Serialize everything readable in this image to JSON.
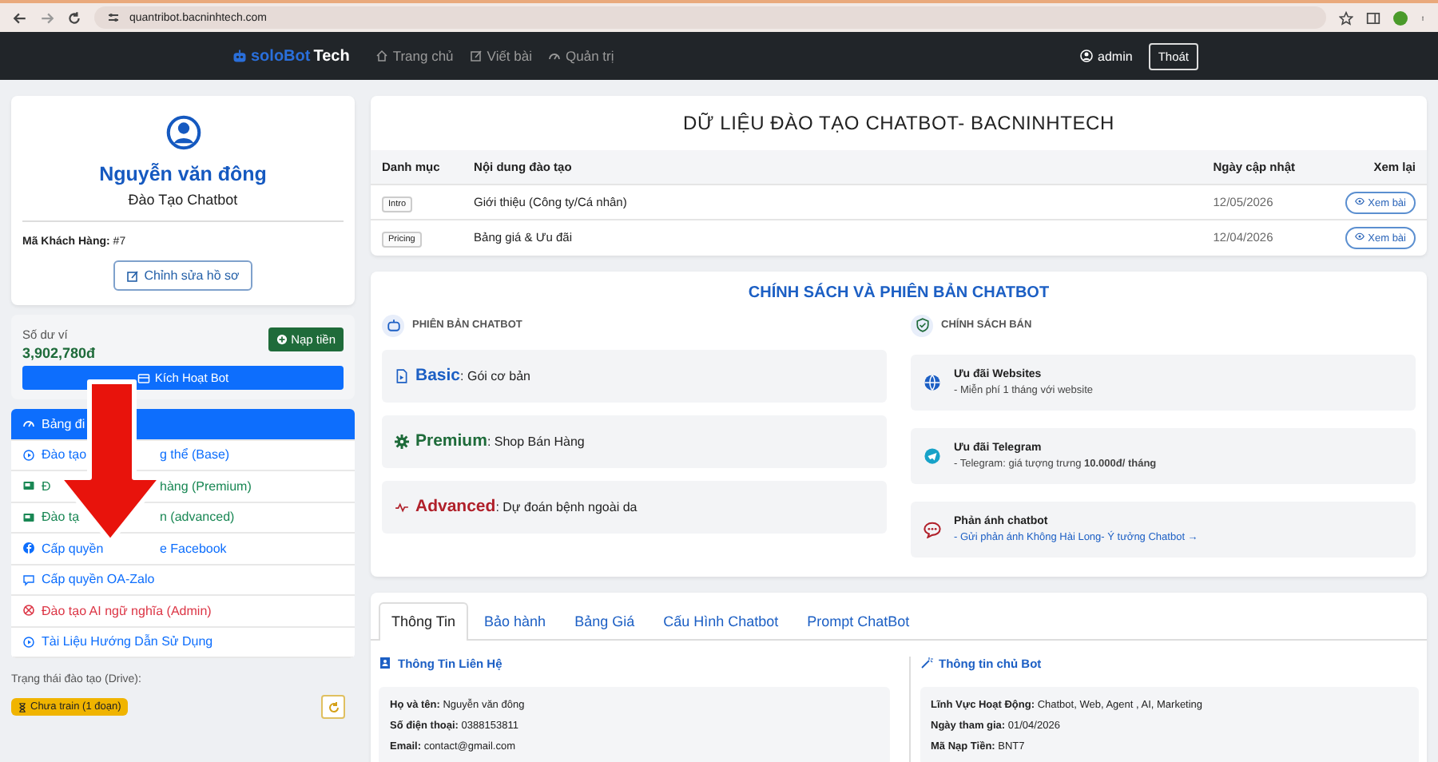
{
  "browser": {
    "url": "quantribot.bacninhtech.com"
  },
  "nav": {
    "logo_accent": "soloBot",
    "logo_rest": "Tech",
    "links": [
      {
        "label": "Trang chủ",
        "kind": "home"
      },
      {
        "label": "Viết bài",
        "kind": "edit"
      },
      {
        "label": "Quản trị",
        "kind": "gauge"
      }
    ],
    "user": "admin",
    "logout": "Thoát"
  },
  "profile": {
    "name": "Nguyễn văn đông",
    "role": "Đào Tạo Chatbot",
    "customer_id_label": "Mã Khách Hàng:",
    "customer_id": "#7",
    "edit_button": "Chỉnh sửa hồ sơ"
  },
  "wallet": {
    "label": "Số dư ví",
    "balance": "3,902,780đ",
    "topup_button": "Nạp tiền",
    "activate_button": "Kích Hoạt Bot"
  },
  "sidebar": {
    "items": [
      {
        "label": "Bảng đi",
        "kind": "dashboard",
        "color": "#0d6efd",
        "selected": true
      },
      {
        "label": "Đào tạo",
        "label_end": "g thể (Base)",
        "kind": "training",
        "color": "#0d6efd",
        "selected": false
      },
      {
        "label": "Đ",
        "label_end": "hàng (Premium)",
        "kind": "premium",
        "color": "#198754",
        "selected": false
      },
      {
        "label": "Đào tạ",
        "label_end": "n (advanced)",
        "kind": "premium",
        "color": "#198754",
        "selected": false
      },
      {
        "label": "Cấp quyền",
        "label_end": "e Facebook",
        "kind": "facebook",
        "color": "#0d6efd",
        "selected": false
      },
      {
        "label": "Cấp quyền OA-Zalo",
        "kind": "zalo",
        "color": "#0d6efd",
        "selected": false
      },
      {
        "label": "Đào tạo AI ngữ nghĩa (Admin)",
        "kind": "admin",
        "color": "#dc3545",
        "selected": false
      },
      {
        "label": "Tài Liệu Hướng Dẫn Sử Dụng",
        "kind": "training",
        "color": "#0d6efd",
        "selected": false
      }
    ],
    "status_label": "Trạng thái đào tạo (Drive):",
    "status_badge": "Chưa train (1 đoạn)"
  },
  "training": {
    "title": "DỮ LIỆU ĐÀO TẠO CHATBOT- BACNINHTECH",
    "columns": [
      "Danh mục",
      "Nội dung đào tạo",
      "Ngày cập nhật",
      "Xem lại"
    ],
    "rows": [
      {
        "tag": "Intro",
        "content": "Giới thiệu (Công ty/Cá nhân)",
        "date": "12/05/2026",
        "action": "Xem bài"
      },
      {
        "tag": "Pricing",
        "content": "Bảng giá & Ưu đãi",
        "date": "12/04/2026",
        "action": "Xem bài"
      }
    ]
  },
  "policy": {
    "title": "CHÍNH SÁCH VÀ PHIÊN BẢN CHATBOT",
    "versions_heading": "PHIÊN BẢN CHATBOT",
    "versions": [
      {
        "kind": "basic",
        "name": "Basic",
        "desc": ": Gói cơ bản"
      },
      {
        "kind": "premium",
        "name": "Premium",
        "desc": ": Shop Bán Hàng"
      },
      {
        "kind": "advanced",
        "name": "Advanced",
        "desc": ": Dự đoán bệnh ngoài da"
      }
    ],
    "policies_heading": "CHÍNH SÁCH BÁN",
    "policies": [
      {
        "kind": "web",
        "title": "Ưu đãi Websites",
        "desc": "- Miễn phí 1 tháng với website"
      },
      {
        "kind": "telegram",
        "title": "Ưu đãi Telegram",
        "desc": "- Telegram: giá tượng trưng **10.000đ/ tháng**"
      },
      {
        "kind": "feedback",
        "title": "Phản ánh chatbot",
        "link": "- Gửi phản ánh Không Hài Long- Ý tưởng Chatbot →"
      }
    ]
  },
  "tabs": [
    {
      "label": "Thông Tin",
      "selected": true
    },
    {
      "label": "Bảo hành",
      "selected": false
    },
    {
      "label": "Bảng Giá",
      "selected": false
    },
    {
      "label": "Cấu Hình Chatbot",
      "selected": false
    },
    {
      "label": "Prompt ChatBot",
      "selected": false
    }
  ],
  "contact": {
    "heading": "Thông Tin Liên Hệ",
    "fields": [
      {
        "label": "Họ và tên:",
        "value": "Nguyễn văn đông"
      },
      {
        "label": "Số điện thoại:",
        "value": "0388153811"
      },
      {
        "label": "Email:",
        "value": "contact@gmail.com"
      }
    ]
  },
  "owner": {
    "heading": "Thông tin chủ Bot",
    "fields": [
      {
        "label": "Lĩnh Vực Hoạt Động:",
        "value": "Chatbot, Web, Agent , AI, Marketing"
      },
      {
        "label": "Ngày tham gia:",
        "value": "01/04/2026"
      },
      {
        "label": "Mã Nạp Tiền:",
        "value": "BNT7"
      }
    ]
  }
}
